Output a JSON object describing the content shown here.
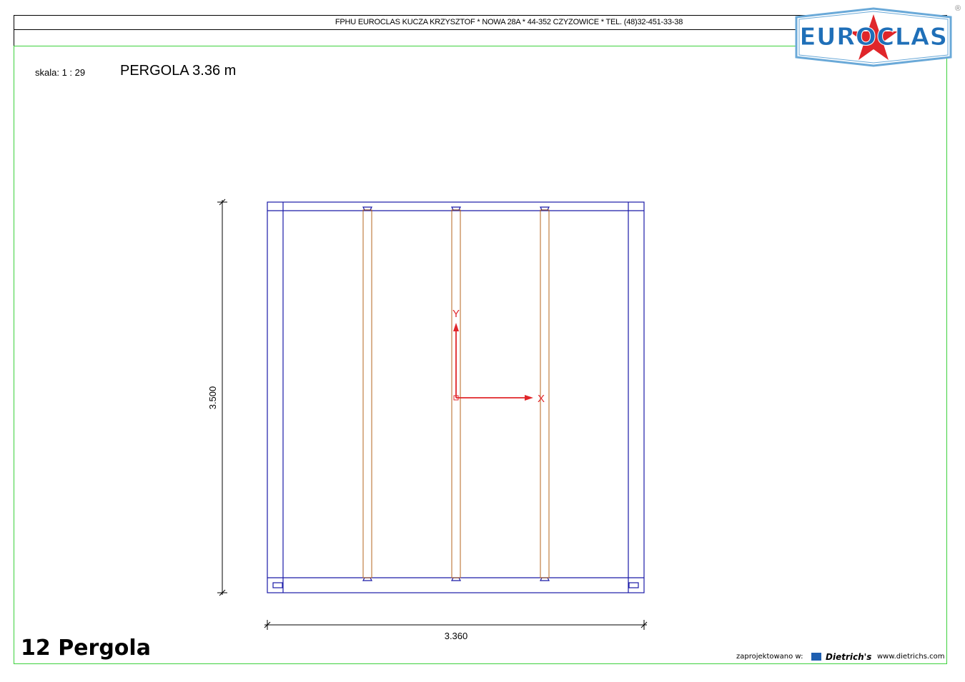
{
  "header": {
    "company_line": "FPHU EUROCLAS KUCZA KRZYSZTOF * NOWA 28A * 44-352 CZYZOWICE * TEL. (48)32-451-33-38"
  },
  "logo": {
    "text": "EUROCLAS",
    "registered_mark": "®",
    "colors": {
      "blue": "#1f6fb8",
      "star": "#e0262a",
      "frame": "#6aa9d8"
    }
  },
  "drawing": {
    "scale_label": "skala: 1 : 29",
    "title": "PERGOLA  3.36 m",
    "dim_height": "3.500",
    "dim_width": "3.360",
    "axis_x_label": "X",
    "axis_y_label": "Y",
    "colors": {
      "frame": "#1a1aa8",
      "beam": "#b5651d",
      "axis": "#e0262a",
      "border": "#3cd13c"
    }
  },
  "footer": {
    "project_name": "12 Pergola",
    "designed_in": "zaprojektowano w:",
    "brand": "Dietrich's",
    "url": "www.dietrichs.com"
  }
}
